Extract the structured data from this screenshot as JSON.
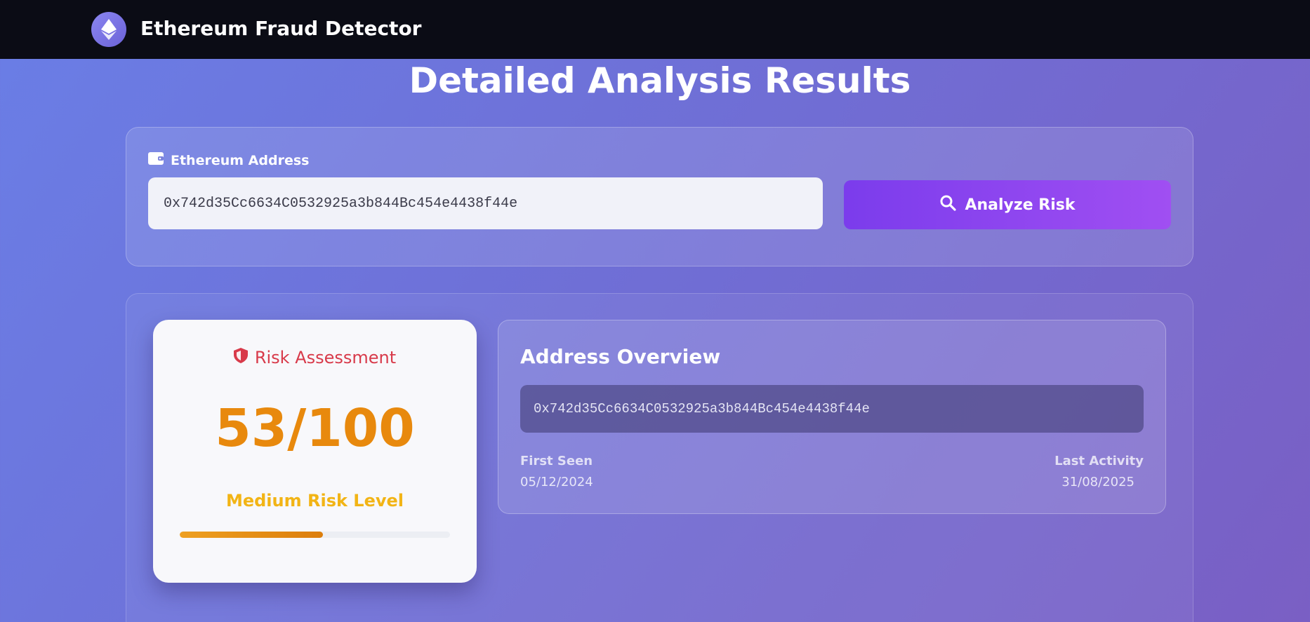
{
  "app": {
    "name": "Ethereum Fraud Detector",
    "logo_icon": "ethereum-icon"
  },
  "page": {
    "title": "Detailed Analysis Results"
  },
  "search": {
    "label": "Ethereum Address",
    "label_icon": "wallet-icon",
    "address_value": "0x742d35Cc6634C0532925a3b844Bc454e4438f44e",
    "button_label": "Analyze Risk",
    "button_icon": "search-icon"
  },
  "risk": {
    "heading": "Risk Assessment",
    "heading_icon": "shield-icon",
    "score_display": "53/100",
    "score": 53,
    "max_score": 100,
    "level": "Medium Risk Level",
    "progress_fraction": 0.53
  },
  "overview": {
    "title": "Address Overview",
    "address": "0x742d35Cc6634C0532925a3b844Bc454e4438f44e",
    "first_seen_label": "First Seen",
    "first_seen_value": "05/12/2024",
    "last_activity_label": "Last Activity",
    "last_activity_value": "31/08/2025"
  },
  "colors": {
    "navbar": "#0b0c15",
    "accent_purple": "#8b3fee",
    "risk_red": "#d83a4a",
    "score_orange": "#e8890d",
    "level_yellow": "#f2b415"
  }
}
